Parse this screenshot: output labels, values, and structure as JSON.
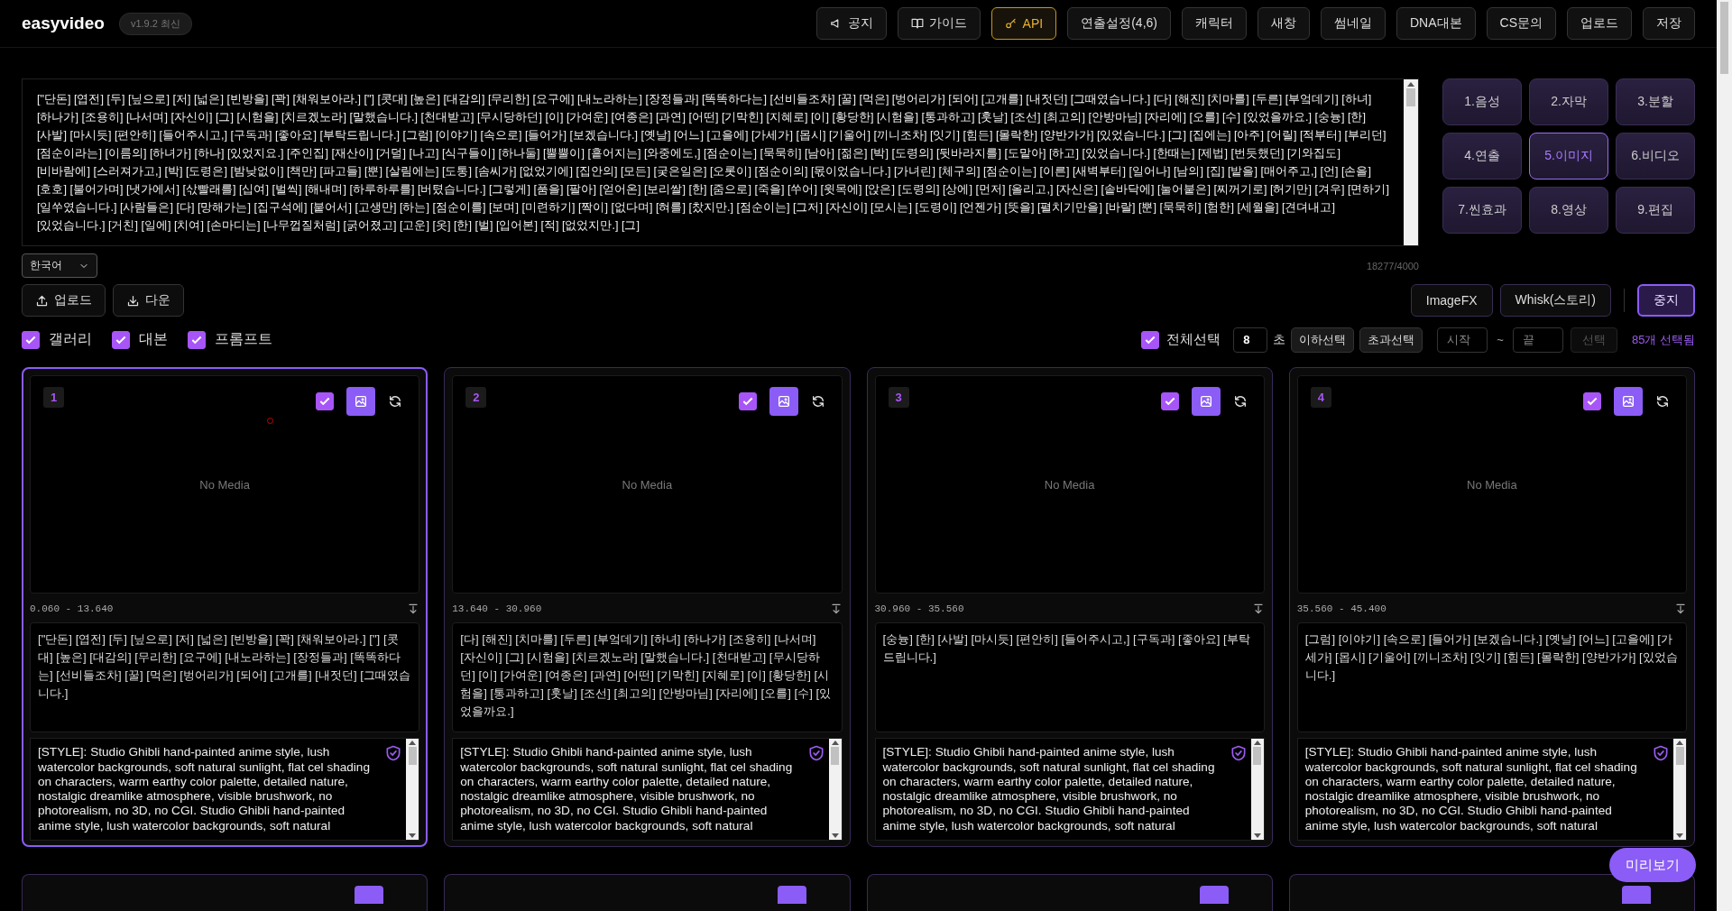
{
  "header": {
    "logo": "easyvideo",
    "version": "v1.9.2 최신",
    "buttons": [
      {
        "label": "공지",
        "selected": false
      },
      {
        "label": "가이드",
        "selected": false
      },
      {
        "label": "API",
        "selected": true
      },
      {
        "label": "연출설정(4,6)",
        "selected": false
      },
      {
        "label": "캐릭터",
        "selected": false
      },
      {
        "label": "새창",
        "selected": false
      },
      {
        "label": "썸네일",
        "selected": false
      },
      {
        "label": "DNA대본",
        "selected": false
      },
      {
        "label": "CS문의",
        "selected": false
      },
      {
        "label": "업로드",
        "selected": false
      },
      {
        "label": "저장",
        "selected": false
      }
    ]
  },
  "script_input": {
    "text": "[\"단돈] [엽전] [두] [닢으로] [저] [넓은] [빈방을] [꽉] [채워보아라.] [\"] [콧대] [높은] [대감의] [무리한] [요구에] [내노라하는] [장정들과] [똑똑하다는] [선비들조차] [꿀] [먹은] [벙어리가] [되어] [고개를] [내젓던] [그때였습니다.] [다] [해진] [치마를] [두른] [부엌데기] [하녀] [하나가] [조용히] [나서며] [자신이] [그] [시험을] [치르겠노라] [말했습니다.] [천대받고] [무시당하던] [이] [가여운] [여종은] [과연] [어떤] [기막힌] [지혜로] [이] [황당한] [시험을] [통과하고] [훗날] [조선] [최고의] [안방마님] [자리에] [오를] [수] [있었을까요.] [숭늉] [한] [사발] [마시듯] [편안히] [들어주시고,] [구독과] [좋아요] [부탁드립니다.] [그럼] [이야기] [속으로] [들어가] [보겠습니다.] [옛날] [어느] [고을에] [가세가] [몹시] [기울어] [끼니조차] [잇기] [힘든] [몰락한] [양반가가] [있었습니다.] [그] [집에는] [아주] [어릴] [적부터] [부리던] [점순이라는] [이름의] [하녀가] [하나] [있었지요.] [주인집] [재산이] [거덜] [나고] [식구들이] [하나둘] [뿔뿔이] [흩어지는] [와중에도,] [점순이는] [묵묵히] [남아] [젊은] [박] [도령의] [뒷바라지를] [도맡아] [하고] [있었습니다.] [한때는] [제법] [번듯했던] [기와집도] [비바람에] [스러져가고,] [박] [도령은] [밤낮없이] [책만] [파고들] [뿐] [살림에는] [도통] [솜씨가] [없었기에] [집안의] [모든] [궂은일은] [오롯이] [점순이의] [몫이었습니다.] [가녀린] [체구의] [점순이는] [이른] [새벽부터] [일어나] [남의] [집] [밭을] [매어주고,] [언] [손을] [호호] [불어가며] [냇가에서] [삯빨래를] [십여] [벌씩] [해내며] [하루하루를] [버텼습니다.] [그렇게] [품을] [팔아] [얻어온] [보리쌀] [한] [줌으로] [죽을] [쑤어] [윗목에] [앉은] [도령의] [상에] [먼저] [올리고,] [자신은] [솥바닥에] [눌어붙은] [찌꺼기로] [허기만] [겨우] [면하기] [일쑤였습니다.] [사람들은] [다] [망해가는] [집구석에] [붙어서] [고생만] [하는] [점순이를] [보며] [미련하기] [짝이] [없다며] [혀를] [찼지만.] [점순이는] [그저] [자신이] [모시는] [도령이] [언젠가] [뜻을] [펼치기만을] [바랄] [뿐] [묵묵히] [험한] [세월을] [견뎌내고] [있었습니다.] [거친] [일에] [치여] [손마디는] [나무껍질처럼] [굵어졌고] [고운] [옷] [한] [벌] [입어본] [적] [없었지만.] [그]",
    "language": "한국어",
    "counter": "18277/4000"
  },
  "steps": [
    {
      "label": "1.음성",
      "selected": false
    },
    {
      "label": "2.자막",
      "selected": false
    },
    {
      "label": "3.분할",
      "selected": false
    },
    {
      "label": "4.연출",
      "selected": false
    },
    {
      "label": "5.이미지",
      "selected": true
    },
    {
      "label": "6.비디오",
      "selected": false
    },
    {
      "label": "7.씬효과",
      "selected": false
    },
    {
      "label": "8.영상",
      "selected": false
    },
    {
      "label": "9.편집",
      "selected": false
    }
  ],
  "file_buttons": [
    {
      "label": "업로드"
    },
    {
      "label": "다운"
    }
  ],
  "generator_buttons": [
    {
      "label": "ImageFX",
      "kind": "outline"
    },
    {
      "label": "Whisk(스토리)",
      "kind": "outline"
    },
    {
      "label": "중지",
      "kind": "primary"
    }
  ],
  "view_toggles": [
    {
      "label": "갤러리",
      "checked": true
    },
    {
      "label": "대본",
      "checked": true
    },
    {
      "label": "프롬프트",
      "checked": true
    }
  ],
  "selection": {
    "select_all": {
      "label": "전체선택",
      "checked": true
    },
    "seconds": "8",
    "seconds_unit": "초",
    "below_button": "이하선택",
    "above_button": "초과선택",
    "start_placeholder": "시작",
    "separator": "~",
    "end_placeholder": "끝",
    "range_button": {
      "label": "선택",
      "disabled": true
    },
    "selected_count": "85개 선택됨"
  },
  "cards": [
    {
      "number": "1",
      "selected": true,
      "checked": true,
      "loading": true,
      "media": "No Media",
      "time_range": "0.060 - 13.640",
      "script": "[\"단돈] [엽전] [두] [닢으로] [저] [넓은] [빈방을] [꽉] [채워보아라.] [\"] [콧대] [높은] [대감의] [무리한] [요구에] [내노라하는] [장정들과] [똑똑하다는] [선비들조차] [꿀] [먹은] [벙어리가] [되어] [고개를] [내젓던] [그때였습니다.]",
      "prompt": "[STYLE]: Studio Ghibli hand-painted anime style, lush watercolor backgrounds, soft natural sunlight, flat cel shading on characters, warm earthy color palette, detailed nature, nostalgic dreamlike atmosphere, visible brushwork, no photorealism, no 3D, no CGI. Studio Ghibli hand-painted anime style, lush watercolor backgrounds, soft natural"
    },
    {
      "number": "2",
      "selected": false,
      "checked": true,
      "loading": false,
      "media": "No Media",
      "time_range": "13.640 - 30.960",
      "script": "[다] [해진] [치마를] [두른] [부엌데기] [하녀] [하나가] [조용히] [나서며] [자신이] [그] [시험을] [치르겠노라] [말했습니다.] [천대받고] [무시당하던] [이] [가여운] [여종은] [과연] [어떤] [기막힌] [지혜로] [이] [황당한] [시험을] [통과하고] [훗날] [조선] [최고의] [안방마님] [자리에] [오를] [수] [있었을까요.]",
      "prompt": "[STYLE]: Studio Ghibli hand-painted anime style, lush watercolor backgrounds, soft natural sunlight, flat cel shading on characters, warm earthy color palette, detailed nature, nostalgic dreamlike atmosphere, visible brushwork, no photorealism, no 3D, no CGI. Studio Ghibli hand-painted anime style, lush watercolor backgrounds, soft natural"
    },
    {
      "number": "3",
      "selected": false,
      "checked": true,
      "loading": false,
      "media": "No Media",
      "time_range": "30.960 - 35.560",
      "script": "[숭늉] [한] [사발] [마시듯] [편안히] [들어주시고,] [구독과] [좋아요] [부탁드립니다.]",
      "prompt": "[STYLE]: Studio Ghibli hand-painted anime style, lush watercolor backgrounds, soft natural sunlight, flat cel shading on characters, warm earthy color palette, detailed nature, nostalgic dreamlike atmosphere, visible brushwork, no photorealism, no 3D, no CGI. Studio Ghibli hand-painted anime style, lush watercolor backgrounds, soft natural"
    },
    {
      "number": "4",
      "selected": false,
      "checked": true,
      "loading": false,
      "media": "No Media",
      "time_range": "35.560 - 45.400",
      "script": "[그럼] [이야기] [속으로] [들어가] [보겠습니다.] [옛날] [어느] [고을에] [가세가] [몹시] [기울어] [끼니조차] [잇기] [힘든] [몰락한] [양반가가] [있었습니다.]",
      "prompt": "[STYLE]: Studio Ghibli hand-painted anime style, lush watercolor backgrounds, soft natural sunlight, flat cel shading on characters, warm earthy color palette, detailed nature, nostalgic dreamlike atmosphere, visible brushwork, no photorealism, no 3D, no CGI. Studio Ghibli hand-painted anime style, lush watercolor backgrounds, soft natural"
    }
  ],
  "preview_button": "미리보기"
}
